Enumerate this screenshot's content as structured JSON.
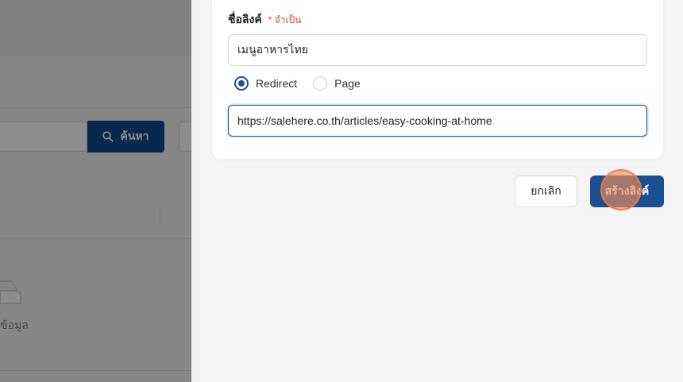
{
  "background": {
    "search_button_label": "ค้นหา",
    "empty_state_text": "ข้อมูล"
  },
  "form": {
    "name_label": "ชื่อลิงค์",
    "required_text": "* จำเป็น",
    "name_value": "เมนูอาหารไทย",
    "link_type_options": [
      {
        "label": "Redirect",
        "checked": true
      },
      {
        "label": "Page",
        "checked": false
      }
    ],
    "url_value": "https://salehere.co.th/articles/easy-cooking-at-home"
  },
  "actions": {
    "cancel_label": "ยกเลิก",
    "create_label": "สร้างลิงค์"
  },
  "colors": {
    "primary": "#1a4f92",
    "required": "#e0403a",
    "search_button": "#0f4c8f"
  }
}
